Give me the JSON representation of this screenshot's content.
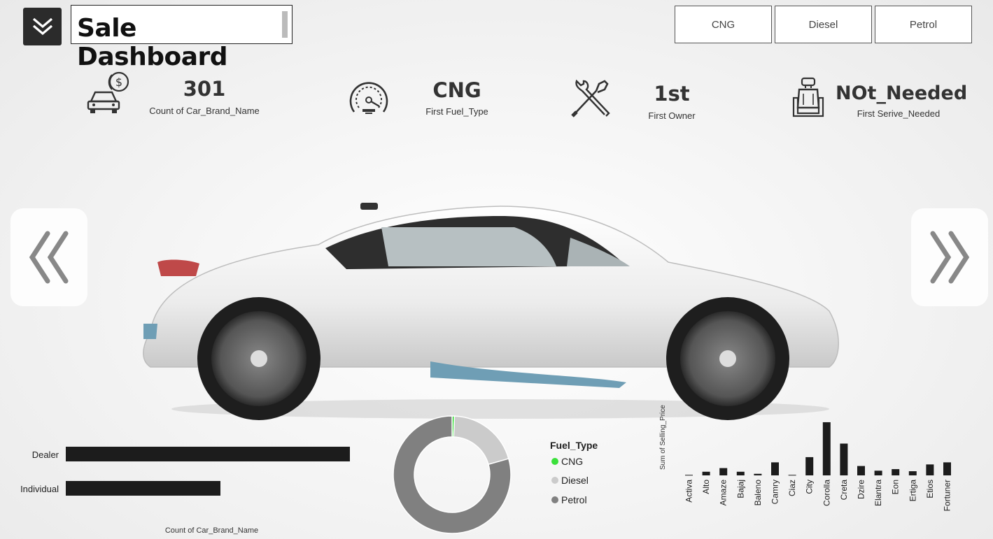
{
  "header": {
    "title": "Sale Dashboard",
    "menu_icon": "chevron-double-down-icon"
  },
  "filters": {
    "buttons": [
      "CNG",
      "Diesel",
      "Petrol"
    ]
  },
  "kpis": [
    {
      "value": "301",
      "label": "Count of Car_Brand_Name",
      "icon": "car-dollar-icon"
    },
    {
      "value": "CNG",
      "label": "First Fuel_Type",
      "icon": "speedometer-icon"
    },
    {
      "value": "1st",
      "label": "First Owner",
      "icon": "tools-icon"
    },
    {
      "value": "NOt_Needed",
      "label": "First Serive_Needed",
      "icon": "car-seat-icon"
    }
  ],
  "hero": {
    "image": "white-sports-car-side-view",
    "prev_icon": "chevron-double-left-icon",
    "next_icon": "chevron-double-right-icon"
  },
  "chart_data": [
    {
      "type": "bar",
      "orientation": "horizontal",
      "categories": [
        "Dealer",
        "Individual"
      ],
      "values": [
        195,
        106
      ],
      "xlabel": "Count of Car_Brand_Name",
      "color": "#1c1c1c"
    },
    {
      "type": "pie",
      "style": "donut",
      "legend_title": "Fuel_Type",
      "categories": [
        "CNG",
        "Diesel",
        "Petrol"
      ],
      "values": [
        2,
        60,
        239
      ],
      "colors": [
        "#3be03b",
        "#cbcbcb",
        "#808080"
      ]
    },
    {
      "type": "bar",
      "categories": [
        "Activa",
        "Alto",
        "Amaze",
        "Bajaj",
        "Baleno",
        "Camry",
        "Ciaz",
        "City",
        "Corolla",
        "Creta",
        "Dzire",
        "Elantra",
        "Eon",
        "Ertiga",
        "Etios",
        "Fortuner"
      ],
      "values": [
        0.5,
        3.5,
        7,
        3.5,
        1.5,
        12.5,
        0.5,
        17.5,
        51,
        30.5,
        9,
        4.5,
        6,
        4,
        10.5,
        12.5,
        55
      ],
      "ylabel": "Sum of Selling_Price",
      "color": "#1c1c1c"
    }
  ]
}
